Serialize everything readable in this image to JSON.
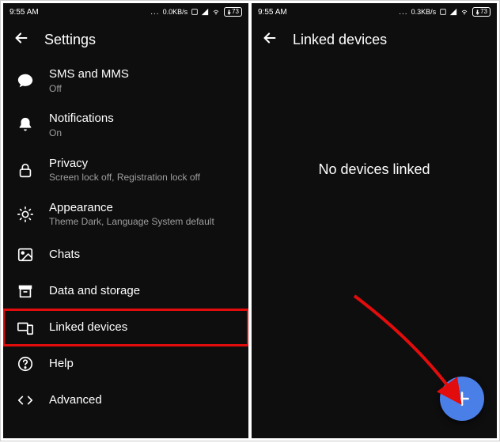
{
  "status": {
    "time": "9:55 AM",
    "net_speed_left": "0.0KB/s",
    "net_speed_right": "0.3KB/s",
    "battery": "73"
  },
  "left_screen": {
    "header_title": "Settings",
    "items": [
      {
        "icon": "chat",
        "title": "SMS and MMS",
        "subtitle": "Off"
      },
      {
        "icon": "bell",
        "title": "Notifications",
        "subtitle": "On"
      },
      {
        "icon": "lock",
        "title": "Privacy",
        "subtitle": "Screen lock off, Registration lock off"
      },
      {
        "icon": "brightness",
        "title": "Appearance",
        "subtitle": "Theme Dark, Language System default"
      },
      {
        "icon": "image",
        "title": "Chats",
        "subtitle": ""
      },
      {
        "icon": "archive",
        "title": "Data and storage",
        "subtitle": ""
      },
      {
        "icon": "devices",
        "title": "Linked devices",
        "subtitle": "",
        "highlighted": true
      },
      {
        "icon": "help",
        "title": "Help",
        "subtitle": ""
      },
      {
        "icon": "code",
        "title": "Advanced",
        "subtitle": ""
      }
    ]
  },
  "right_screen": {
    "header_title": "Linked devices",
    "empty_text": "No devices linked"
  },
  "icons": {
    "chat": "chat-icon",
    "bell": "bell-icon",
    "lock": "lock-icon",
    "brightness": "brightness-icon",
    "image": "image-icon",
    "archive": "archive-icon",
    "devices": "devices-icon",
    "help": "help-icon",
    "code": "code-icon"
  }
}
